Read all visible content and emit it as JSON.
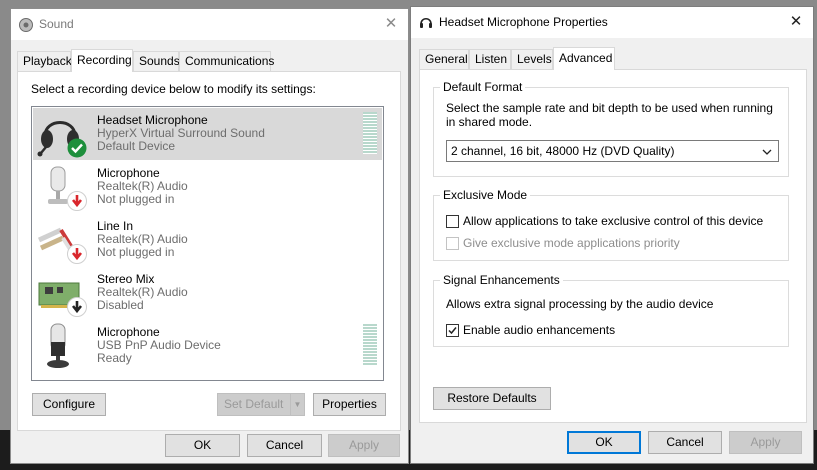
{
  "sound_window": {
    "title": "Sound",
    "close_glyph": "✕",
    "tabs": [
      "Playback",
      "Recording",
      "Sounds",
      "Communications"
    ],
    "active_tab": "Recording",
    "instruction": "Select a recording device below to modify its settings:",
    "devices": [
      {
        "name": "Headset Microphone",
        "driver": "HyperX Virtual Surround Sound",
        "status": "Default Device",
        "icon": "headset-icon",
        "badge": "check-badge-icon",
        "selected": true,
        "meter": true
      },
      {
        "name": "Microphone",
        "driver": "Realtek(R) Audio",
        "status": "Not plugged in",
        "icon": "microphone-icon",
        "badge": "unplugged-badge-icon",
        "selected": false,
        "meter": false
      },
      {
        "name": "Line In",
        "driver": "Realtek(R) Audio",
        "status": "Not plugged in",
        "icon": "line-in-cable-icon",
        "badge": "unplugged-badge-icon",
        "selected": false,
        "meter": false
      },
      {
        "name": "Stereo Mix",
        "driver": "Realtek(R) Audio",
        "status": "Disabled",
        "icon": "sound-card-icon",
        "badge": "disabled-badge-icon",
        "selected": false,
        "meter": false
      },
      {
        "name": "Microphone",
        "driver": "USB PnP Audio Device",
        "status": "Ready",
        "icon": "usb-microphone-icon",
        "badge": "",
        "selected": false,
        "meter": true
      }
    ],
    "configure_label": "Configure",
    "set_default_label": "Set Default",
    "properties_label": "Properties",
    "ok_label": "OK",
    "cancel_label": "Cancel",
    "apply_label": "Apply"
  },
  "props_window": {
    "title": "Headset Microphone Properties",
    "close_glyph": "✕",
    "tabs": [
      "General",
      "Listen",
      "Levels",
      "Advanced"
    ],
    "active_tab": "Advanced",
    "default_format": {
      "title": "Default Format",
      "description": "Select the sample rate and bit depth to be used when running in shared mode.",
      "selected": "2 channel, 16 bit, 48000 Hz (DVD Quality)"
    },
    "exclusive_mode": {
      "title": "Exclusive Mode",
      "allow_label": "Allow applications to take exclusive control of this device",
      "allow_checked": false,
      "priority_label": "Give exclusive mode applications priority",
      "priority_checked": false,
      "priority_enabled": false
    },
    "signal_enhancements": {
      "title": "Signal Enhancements",
      "description": "Allows extra signal processing by the audio device",
      "enable_label": "Enable audio enhancements",
      "enable_checked": true
    },
    "restore_defaults_label": "Restore Defaults",
    "ok_label": "OK",
    "cancel_label": "Cancel",
    "apply_label": "Apply"
  },
  "colors": {
    "selection": "#d9d9d9",
    "default_button_border": "#0078d7",
    "check_badge": "#1e8f3c",
    "unplugged_badge": "#d9262c",
    "meter": "#b8d8cc"
  }
}
